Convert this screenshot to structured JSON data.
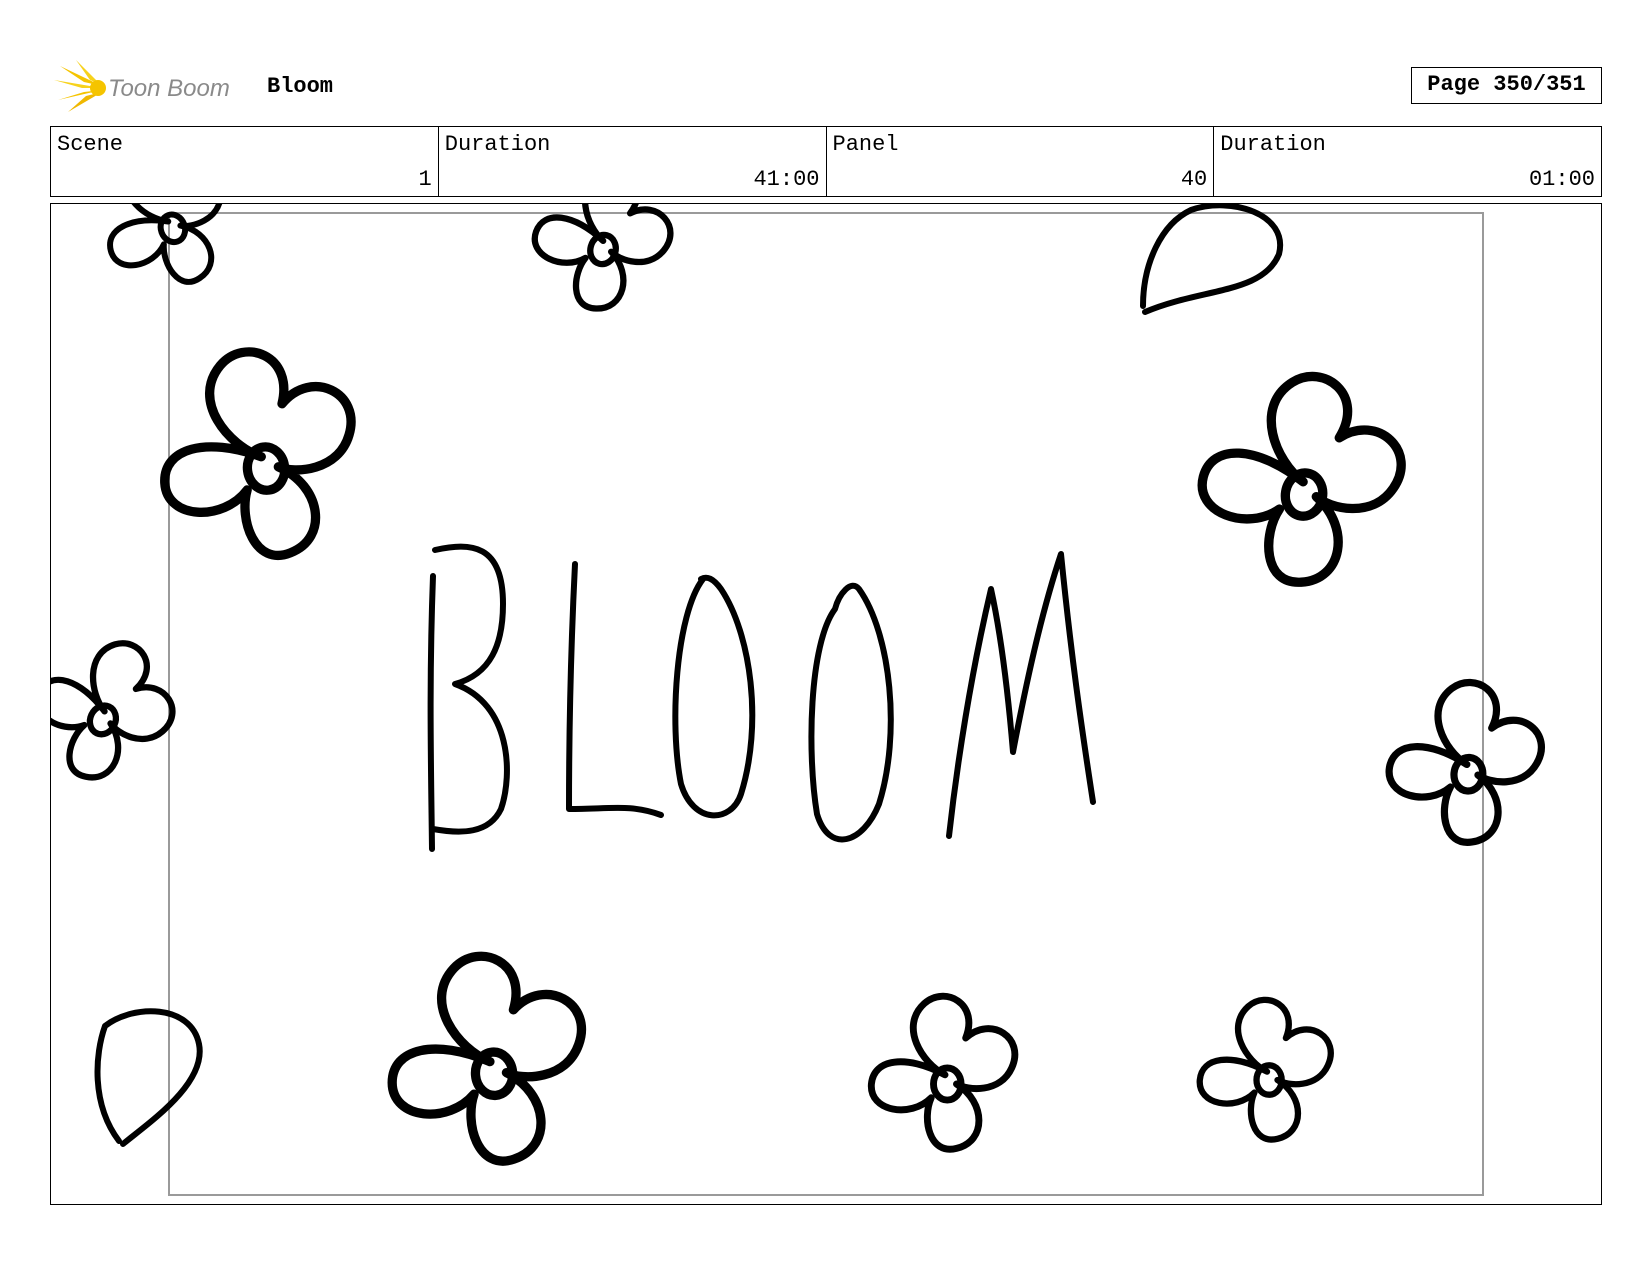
{
  "header": {
    "logo_text": "Toon Boom",
    "project_title": "Bloom",
    "page_label": "Page 350/351"
  },
  "info": {
    "scene_label": "Scene",
    "scene_value": "1",
    "scene_duration_label": "Duration",
    "scene_duration_value": "41:00",
    "panel_label": "Panel",
    "panel_value": "40",
    "panel_duration_label": "Duration",
    "panel_duration_value": "01:00"
  },
  "drawing": {
    "lettering": "BLOOM"
  },
  "colors": {
    "logo_yellow": "#f5c400",
    "logo_gray": "#8a8a8a",
    "safe_frame": "#9a9a9a"
  }
}
